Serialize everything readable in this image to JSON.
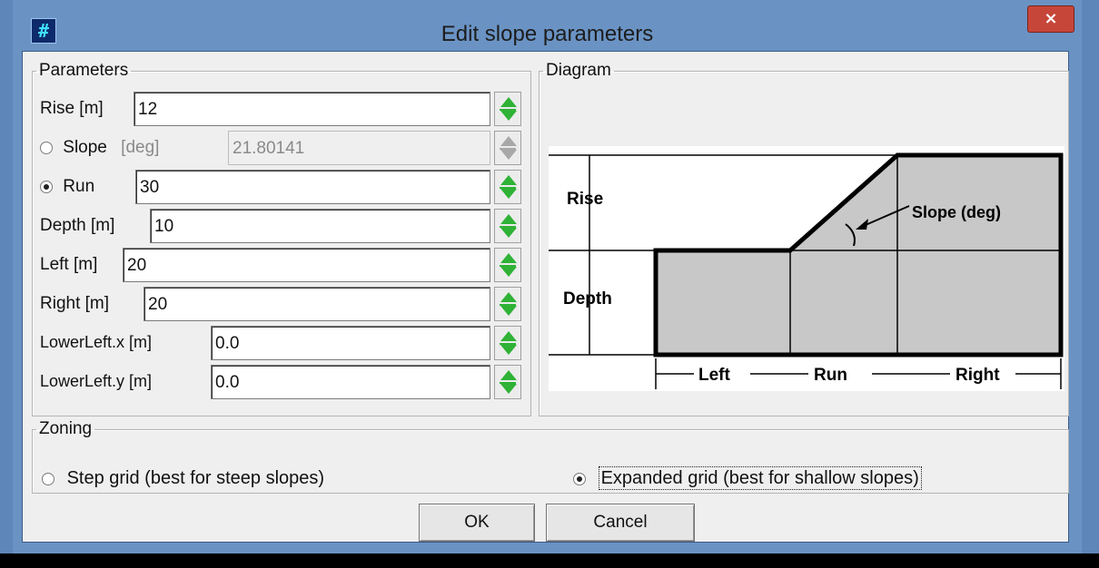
{
  "window": {
    "title": "Edit slope parameters",
    "app_icon": "grid-app-icon",
    "close_glyph": "×"
  },
  "parameters": {
    "legend": "Parameters",
    "rise": {
      "label": "Rise [m]",
      "value": "12"
    },
    "slope": {
      "label": "Slope",
      "unit": "[deg]",
      "value": "21.80141",
      "selected": false
    },
    "run": {
      "label": "Run",
      "value": "30",
      "selected": true
    },
    "depth": {
      "label": "Depth [m]",
      "value": "10"
    },
    "left": {
      "label": "Left [m]",
      "value": "20"
    },
    "right": {
      "label": "Right [m]",
      "value": "20"
    },
    "lowerleft_x": {
      "label": "LowerLeft.x [m]",
      "value": "0.0"
    },
    "lowerleft_y": {
      "label": "LowerLeft.y [m]",
      "value": "0.0"
    }
  },
  "diagram": {
    "legend": "Diagram",
    "labels": {
      "rise": "Rise",
      "depth": "Depth",
      "slope": "Slope (deg)",
      "left": "Left",
      "run": "Run",
      "right": "Right"
    }
  },
  "zoning": {
    "legend": "Zoning",
    "step": {
      "label": "Step grid (best for steep slopes)",
      "selected": false
    },
    "expanded": {
      "label": "Expanded grid (best for shallow slopes)",
      "selected": true
    }
  },
  "buttons": {
    "ok": "OK",
    "cancel": "Cancel"
  },
  "colors": {
    "title_bar": "#6a93c4",
    "close": "#c7463a",
    "spinner_arrow": "#2fb236",
    "diagram_fill": "#c8c8c8"
  }
}
